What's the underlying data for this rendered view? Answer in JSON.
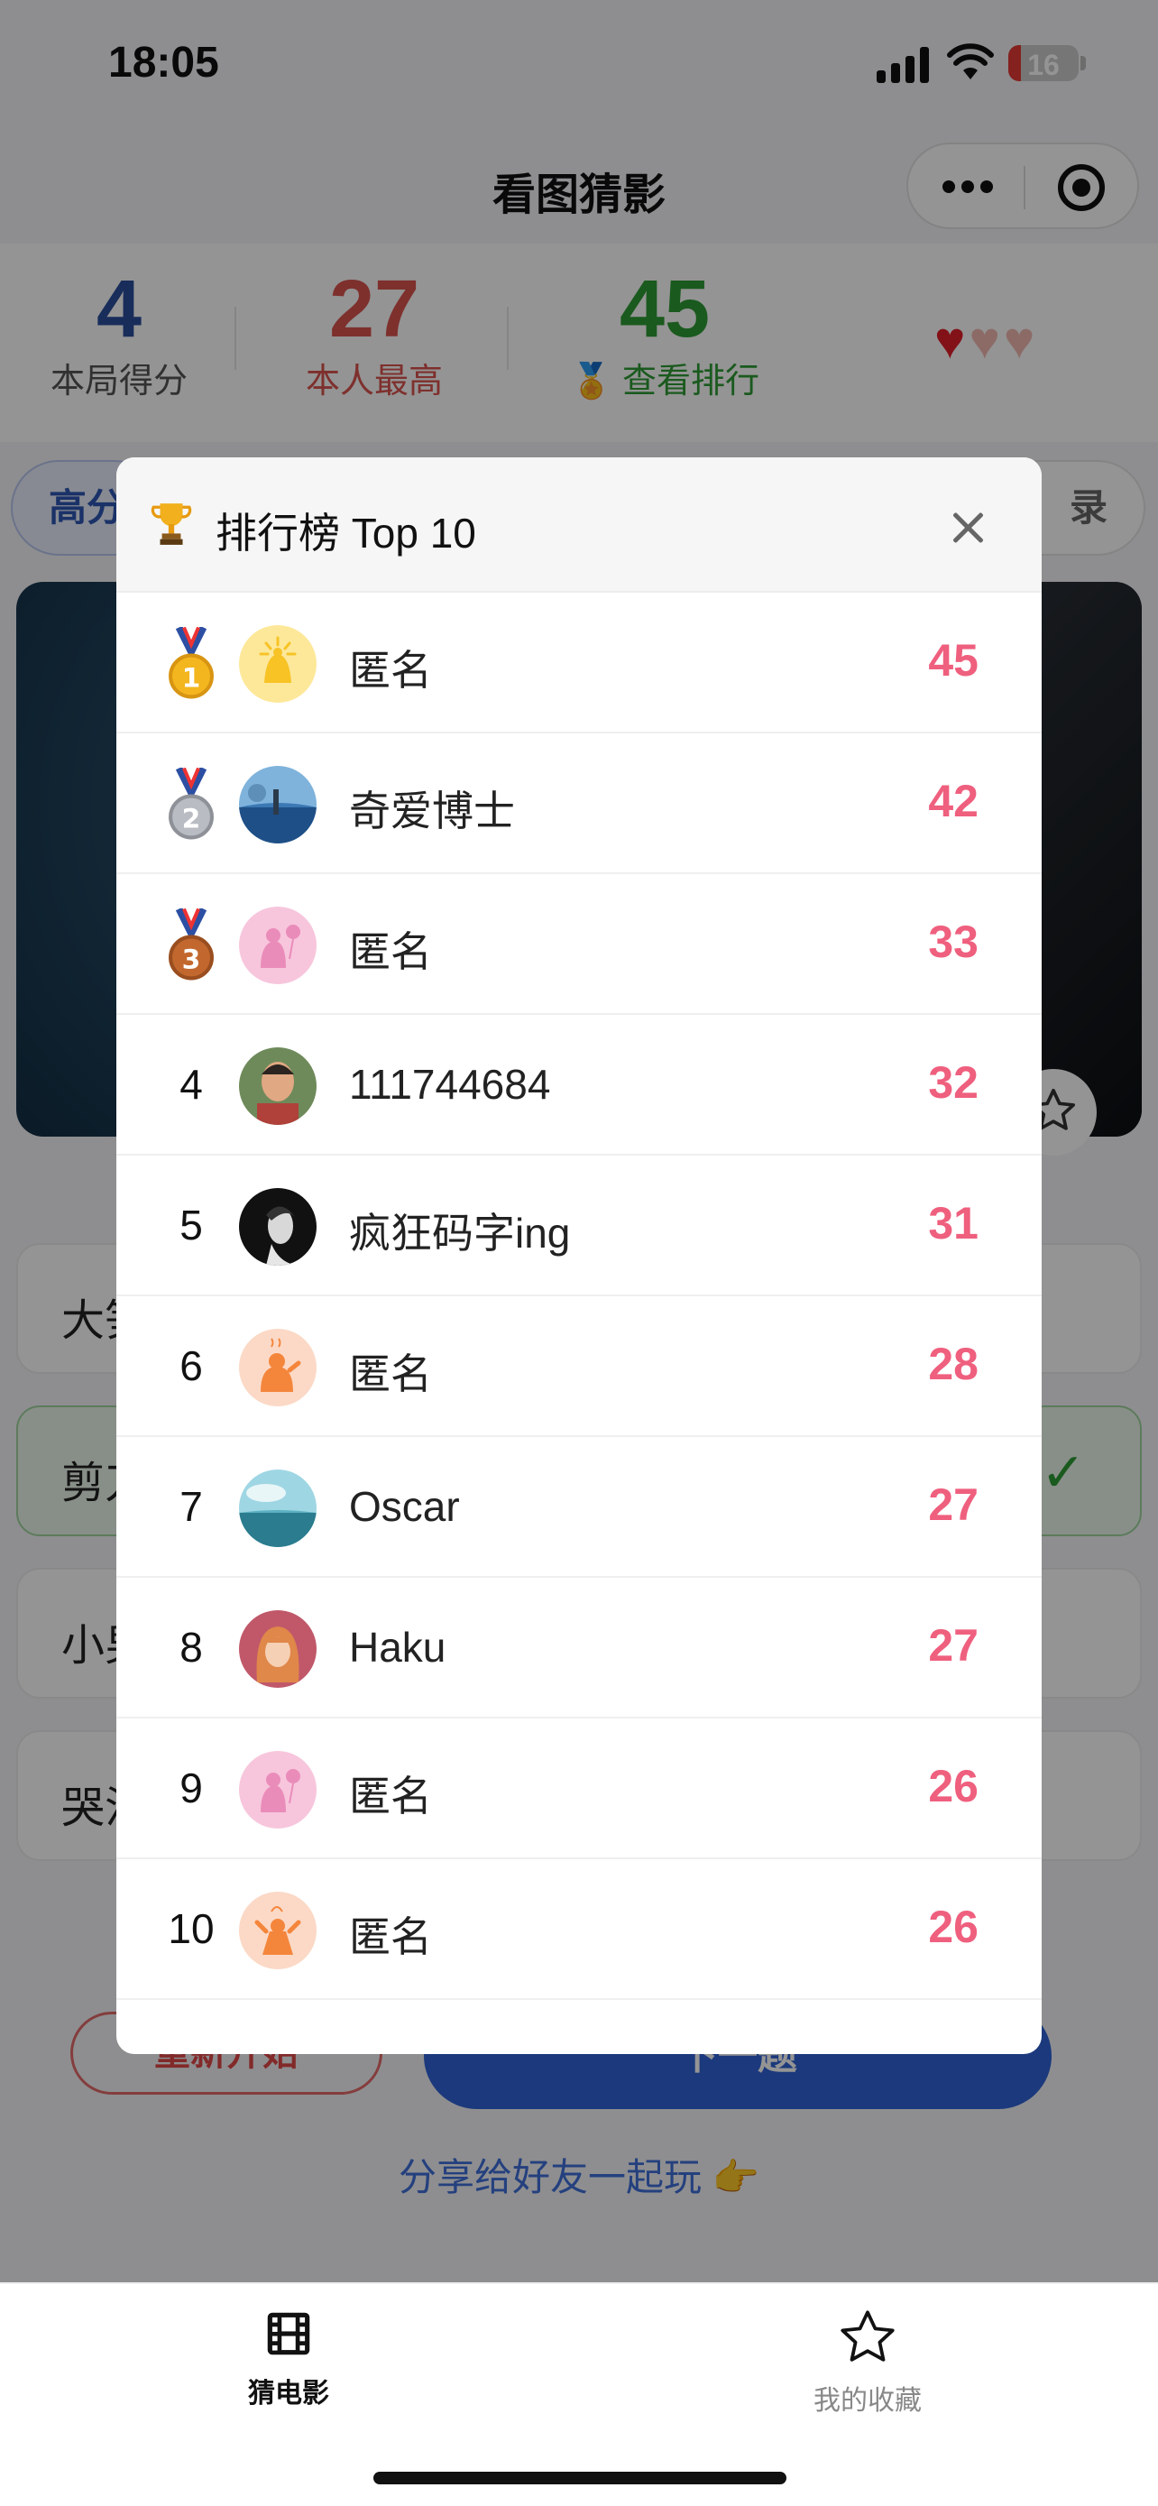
{
  "status": {
    "time": "18:05",
    "battery": "16"
  },
  "nav": {
    "title": "看图猜影"
  },
  "scores": {
    "current": {
      "value": "4",
      "label": "本局得分",
      "color": "#2c4f9e"
    },
    "best": {
      "value": "27",
      "label": "本人最高",
      "color": "#d9534f"
    },
    "rank": {
      "value": "45",
      "label": "查看排行",
      "color": "#2e9b34"
    },
    "lives_total": 3,
    "lives_remaining": 1
  },
  "chips": {
    "left": "高分",
    "right": "录"
  },
  "options": [
    {
      "text": "大笋",
      "state": "normal"
    },
    {
      "text": "剪刀",
      "state": "correct"
    },
    {
      "text": "小男",
      "state": "normal"
    },
    {
      "text": "哭泣",
      "state": "normal"
    }
  ],
  "actions": {
    "restart": "重新开始",
    "next": "下一题",
    "share": "分享给好友一起玩 👉"
  },
  "leaderboard": {
    "title": "排行榜 Top 10",
    "rows": [
      {
        "rank": "1",
        "name": "匿名",
        "score": "45",
        "avatar": "yellow-bell",
        "medal": "gold"
      },
      {
        "rank": "2",
        "name": "奇爱博士",
        "score": "42",
        "avatar": "photo-landscape",
        "medal": "silver"
      },
      {
        "rank": "3",
        "name": "匿名",
        "score": "33",
        "avatar": "pink-balloon",
        "medal": "bronze"
      },
      {
        "rank": "4",
        "name": "111744684",
        "score": "32",
        "avatar": "photo-man",
        "medal": ""
      },
      {
        "rank": "5",
        "name": "疯狂码字ing",
        "score": "31",
        "avatar": "photo-portrait",
        "medal": ""
      },
      {
        "rank": "6",
        "name": "匿名",
        "score": "28",
        "avatar": "orange-figure",
        "medal": ""
      },
      {
        "rank": "7",
        "name": "Oscar",
        "score": "27",
        "avatar": "photo-sea",
        "medal": ""
      },
      {
        "rank": "8",
        "name": "Haku",
        "score": "27",
        "avatar": "photo-anime",
        "medal": ""
      },
      {
        "rank": "9",
        "name": "匿名",
        "score": "26",
        "avatar": "pink-balloon",
        "medal": ""
      },
      {
        "rank": "10",
        "name": "匿名",
        "score": "26",
        "avatar": "orange-figure",
        "medal": ""
      }
    ]
  },
  "tabs": [
    {
      "label": "猜电影",
      "icon": "film-icon",
      "active": true
    },
    {
      "label": "我的收藏",
      "icon": "star-icon",
      "active": false
    }
  ],
  "colors": {
    "accent": "#2f63d6",
    "score_pink": "#ef5f7e",
    "correct_green": "#2e9b34"
  }
}
